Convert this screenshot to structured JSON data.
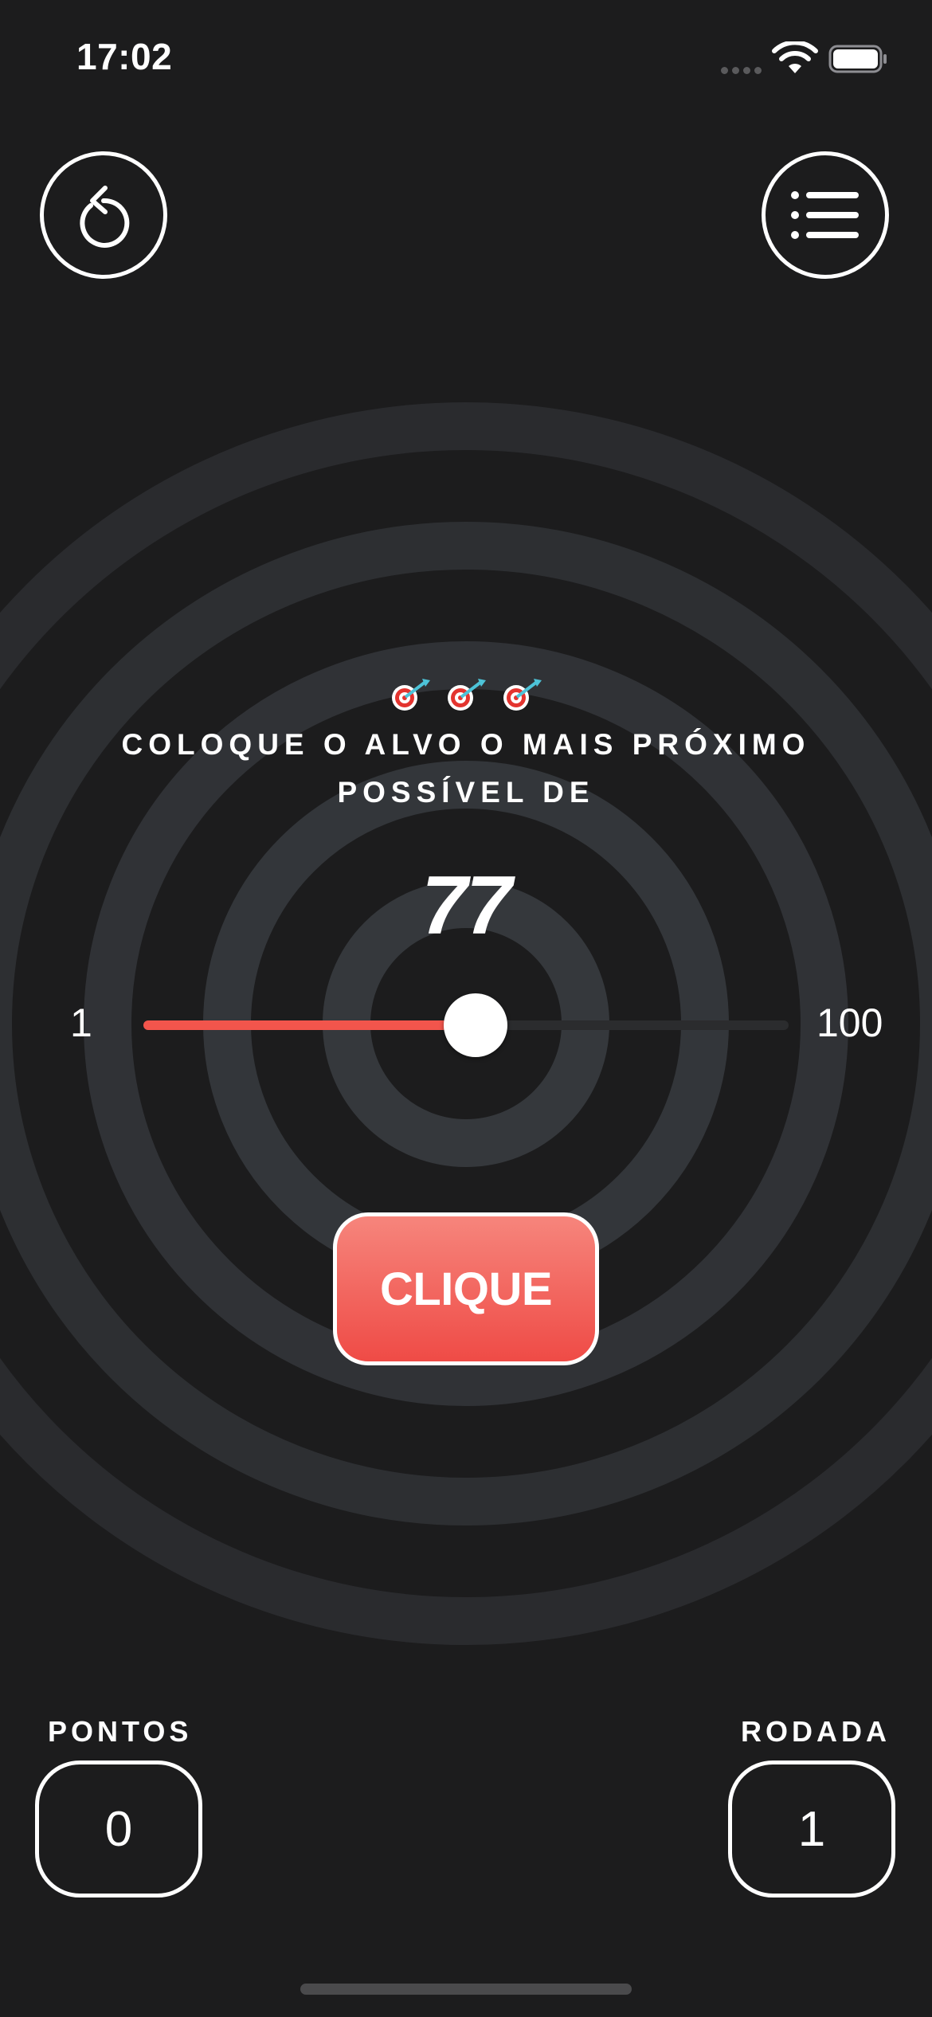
{
  "status_bar": {
    "time": "17:02"
  },
  "toolbar": {
    "restart_icon": "restart-arrow-icon",
    "menu_icon": "list-icon"
  },
  "game": {
    "instruction_line1": "COLOQUE O ALVO O MAIS PRÓXIMO",
    "instruction_line2": "POSSÍVEL DE",
    "target_value": "77",
    "slider": {
      "min_label": "1",
      "max_label": "100",
      "min": 1,
      "max": 100,
      "value": 52,
      "fill_color": "#f2554c"
    },
    "action_button": "CLIQUE"
  },
  "stats": {
    "score_label": "PONTOS",
    "score_value": "0",
    "round_label": "RODADA",
    "round_value": "1"
  },
  "colors": {
    "background": "#1c1c1d",
    "ring": "#2f3135",
    "accent": "#f2554c"
  }
}
